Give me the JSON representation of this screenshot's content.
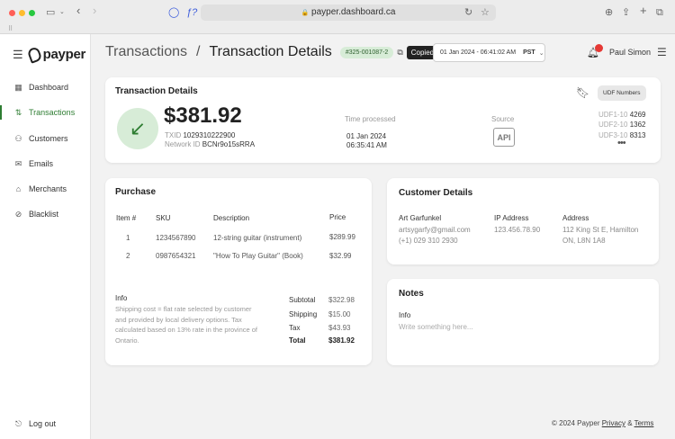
{
  "browser": {
    "url": "payper.dashboard.ca",
    "colors": {
      "close": "#ff5f57",
      "minimize": "#febc2e",
      "maximize": "#28c840"
    }
  },
  "sidebar": {
    "logo_text": "payper",
    "items": [
      {
        "label": "Dashboard",
        "icon": "grid-icon",
        "active": false
      },
      {
        "label": "Transactions",
        "icon": "transactions-icon",
        "active": true
      },
      {
        "label": "Customers",
        "icon": "users-icon",
        "active": false
      },
      {
        "label": "Emails",
        "icon": "mail-icon",
        "active": false
      },
      {
        "label": "Merchants",
        "icon": "store-icon",
        "active": false
      },
      {
        "label": "Blacklist",
        "icon": "ban-icon",
        "active": false
      }
    ],
    "logout_label": "Log out"
  },
  "header": {
    "breadcrumb_root": "Transactions",
    "breadcrumb_sep": "/",
    "breadcrumb_current": "Transaction Details",
    "transaction_id": "#325-001087-2",
    "copied_tooltip": "Copied!",
    "datetime": "01 Jan 2024 - 06:41:02 AM",
    "timezone": "PST",
    "user_name": "Paul Simon"
  },
  "details": {
    "title": "Transaction Details",
    "amount": "$381.92",
    "txid_label": "TXID",
    "txid": "1029310222900",
    "network_label": "Network ID",
    "network_id": "BCNr9o15sRRA",
    "time_label": "Time processed",
    "time_date": "01 Jan 2024",
    "time_clock": "06:35:41 AM",
    "source_label": "Source",
    "source_value": "API",
    "udf_button": "UDF Numbers",
    "udfs": [
      {
        "label": "UDF1-10",
        "value": "4269"
      },
      {
        "label": "UDF2-10",
        "value": "1362"
      },
      {
        "label": "UDF3-10",
        "value": "8313"
      }
    ],
    "more_glyph": "•••"
  },
  "purchase": {
    "title": "Purchase",
    "columns": {
      "item": "Item #",
      "sku": "SKU",
      "desc": "Description",
      "price": "Price"
    },
    "rows": [
      {
        "item": "1",
        "sku": "1234567890",
        "desc": "12-string guitar (instrument)",
        "price": "$289.99"
      },
      {
        "item": "2",
        "sku": "0987654321",
        "desc": "\"How To Play Guitar\" (Book)",
        "price": "$32.99"
      }
    ],
    "info_label": "Info",
    "info_text": "Shipping cost = flat rate selected by customer and provided by local delivery options. Tax calculated based on 13% rate in the province of Ontario.",
    "totals": {
      "subtotal_label": "Subtotal",
      "subtotal": "$322.98",
      "shipping_label": "Shipping",
      "shipping": "$15.00",
      "tax_label": "Tax",
      "tax": "$43.93",
      "total_label": "Total",
      "total": "$381.92"
    }
  },
  "customer": {
    "title": "Customer Details",
    "name": "Art Garfunkel",
    "email": "artsygarfy@gmail.com",
    "phone": "(+1) 029 310 2930",
    "ip_label": "IP Address",
    "ip": "123.456.78.90",
    "address_label": "Address",
    "address_line1": "112 King St E, Hamilton",
    "address_line2": "ON, L8N 1A8"
  },
  "notes": {
    "title": "Notes",
    "info_label": "Info",
    "placeholder": "Write something here..."
  },
  "footer": {
    "copyright": "© 2024 Payper",
    "privacy": "Privacy",
    "amp": "&",
    "terms": "Terms"
  },
  "colors": {
    "accent": "#2e7d32",
    "badge_bg": "#d7ecd7",
    "notification": "#e53935"
  }
}
